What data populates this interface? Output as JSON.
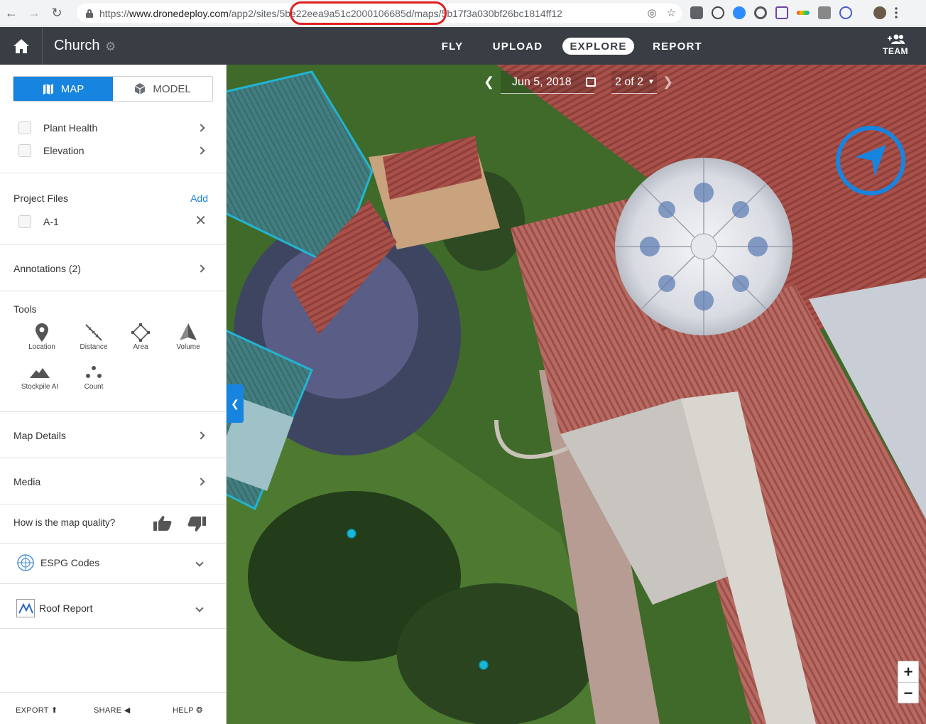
{
  "browser": {
    "url_scheme": "https://",
    "url_host": "www.dronedeploy.com",
    "url_path": "/app2/sites/5be22eea9a51c2000106685d/maps/5b17f3a030bf26bc1814ff12"
  },
  "header": {
    "project_name": "Church",
    "tabs": [
      {
        "label": "FLY",
        "active": false
      },
      {
        "label": "UPLOAD",
        "active": false
      },
      {
        "label": "EXPLORE",
        "active": true
      },
      {
        "label": "REPORT",
        "active": false
      }
    ],
    "team_label": "TEAM"
  },
  "sidebar": {
    "view_toggle": {
      "map": "MAP",
      "model": "MODEL",
      "selected": "MAP"
    },
    "layers": [
      {
        "label": "Plant Health"
      },
      {
        "label": "Elevation"
      }
    ],
    "project_files": {
      "title": "Project Files",
      "add_label": "Add",
      "files": [
        {
          "label": "A-1"
        }
      ]
    },
    "annotations_label": "Annotations (2)",
    "tools": {
      "title": "Tools",
      "items": [
        {
          "label": "Location",
          "icon": "location-pin-icon"
        },
        {
          "label": "Distance",
          "icon": "ruler-icon"
        },
        {
          "label": "Area",
          "icon": "polygon-icon"
        },
        {
          "label": "Volume",
          "icon": "volume-icon"
        },
        {
          "label": "Stockpile AI",
          "icon": "stockpile-icon"
        },
        {
          "label": "Count",
          "icon": "count-dots-icon"
        }
      ]
    },
    "map_details_label": "Map Details",
    "media_label": "Media",
    "quality_question": "How is the map quality?",
    "espg_label": "ESPG Codes",
    "roof_report_label": "Roof Report",
    "footer": {
      "export": "EXPORT",
      "share": "SHARE",
      "help": "HELP"
    }
  },
  "map": {
    "date": "Jun 5, 2018",
    "map_count": "2 of 2",
    "accent_color": "#1784e0",
    "marker_color": "#1ab8d8"
  }
}
